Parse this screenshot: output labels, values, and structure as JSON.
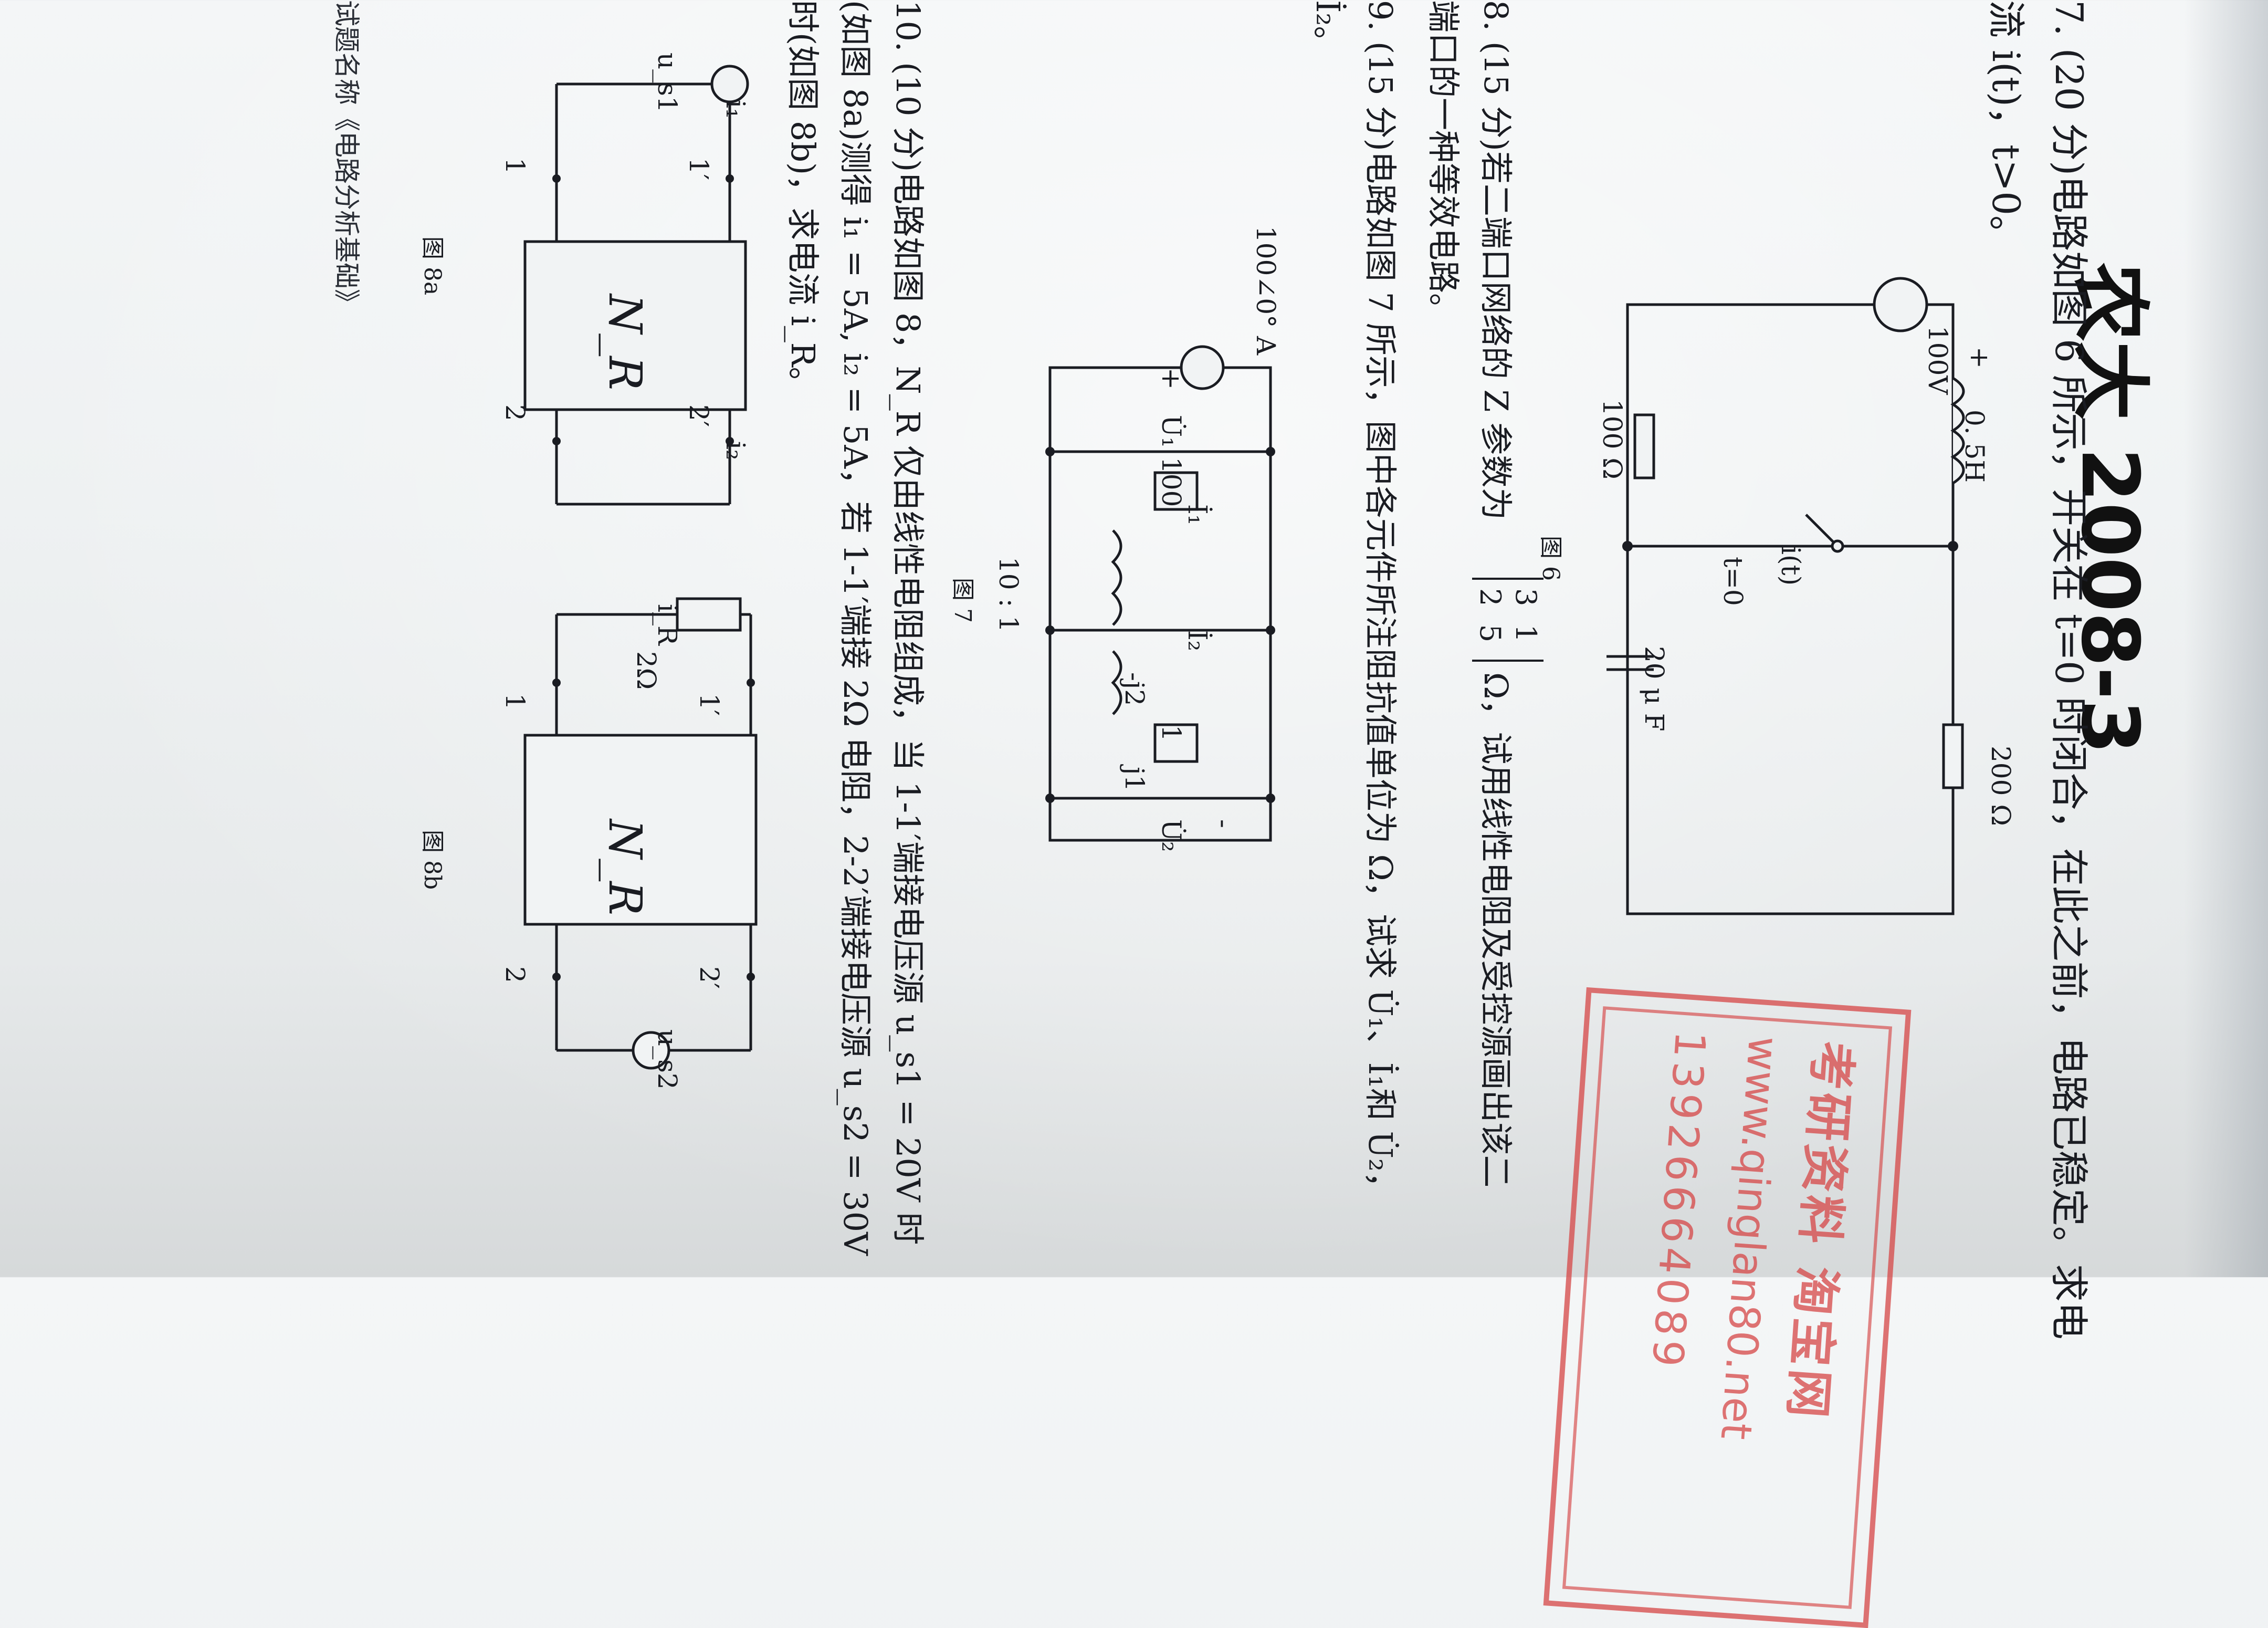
{
  "handwriting": "农大 2008-3",
  "problem7": {
    "line1": "7. (20 分)电路如图 6 所示，开关在 t=0 时闭合，在此之前，电路已稳定。求电",
    "line2": "流 i(t)，t>0。"
  },
  "fig6": {
    "caption": "图 6",
    "source": "100V",
    "plus": "+",
    "inductor": "0. 5H",
    "r1": "100 Ω",
    "r2": "200 Ω",
    "current": "i(t)",
    "switch": "t=0",
    "cap": "20 μ F"
  },
  "problem8": {
    "line1": "8. (15 分)若二端口网络的 Z 参数为",
    "matrix": [
      "3",
      "1",
      "2",
      "5"
    ],
    "line1b": "Ω，试用线性电阻及受控源画出该二",
    "line2": "端口的一种等效电路。"
  },
  "problem9": {
    "line1": "9. (15 分)电路如图 7 所示，图中各元件所注阻抗值单位为 Ω，试求 U̇₁、İ₁和 U̇₂，",
    "line2": "İ₂。"
  },
  "fig7": {
    "caption": "图 7",
    "source": "100∠0° A",
    "u1": "U̇₁",
    "r100": "100",
    "i1": "İ₁",
    "ratio": "10 : 1",
    "i2": "İ₂",
    "ml": "-j2",
    "r1": "1",
    "j1": "j1",
    "u2": "U̇₂",
    "plus": "+",
    "minus": "-"
  },
  "stamp": {
    "line1": "考研资料   淘宝网",
    "line2": "www.qinglan80.net",
    "line3": "13926664089"
  },
  "problem10": {
    "line1": "10. (10 分)电路如图 8，N_R 仅由线性电阻组成，当 1-1′端接电压源 u_s1 = 20V 时",
    "line2": "(如图 8a)测得 i₁ = 5A, i₂ = 5A，若 1-1′端接 2Ω 电阻，2-2′端接电压源 u_s2 = 30V",
    "line3": "时(如图 8b)，求电流 i_R。"
  },
  "fig8a": {
    "caption": "图 8a",
    "us1": "u_s1",
    "i1": "i₁",
    "i2": "i₂",
    "box": "N_R",
    "p1": "1",
    "p1p": "1′",
    "p2": "2",
    "p2p": "2′"
  },
  "fig8b": {
    "caption": "图 8b",
    "r": "2Ω",
    "ir": "i_R",
    "box": "N_R",
    "us2": "u_s2",
    "p1": "1",
    "p1p": "1′",
    "p2": "2",
    "p2p": "2′"
  },
  "footer": "试题名称《电路分析基础》"
}
